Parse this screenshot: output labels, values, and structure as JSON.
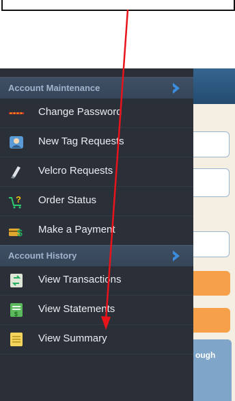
{
  "drawer": {
    "sections": [
      {
        "title": "Account Maintenance",
        "items": [
          {
            "label": "Change Password",
            "icon": "password-dots-icon"
          },
          {
            "label": "New Tag Requests",
            "icon": "tag-person-icon"
          },
          {
            "label": "Velcro Requests",
            "icon": "velcro-icon"
          },
          {
            "label": "Order Status",
            "icon": "cart-question-icon"
          },
          {
            "label": "Make a Payment",
            "icon": "money-card-icon"
          }
        ]
      },
      {
        "title": "Account History",
        "items": [
          {
            "label": "View Transactions",
            "icon": "transactions-icon"
          },
          {
            "label": "View Statements",
            "icon": "statement-icon"
          },
          {
            "label": "View Summary",
            "icon": "summary-icon"
          }
        ]
      }
    ]
  },
  "content": {
    "partial_text": "ough"
  },
  "colors": {
    "drawer_bg": "#2b3038",
    "section_text": "#9fb4cc",
    "chevron": "#3c8de0",
    "annotation_arrow": "#e8141c"
  }
}
